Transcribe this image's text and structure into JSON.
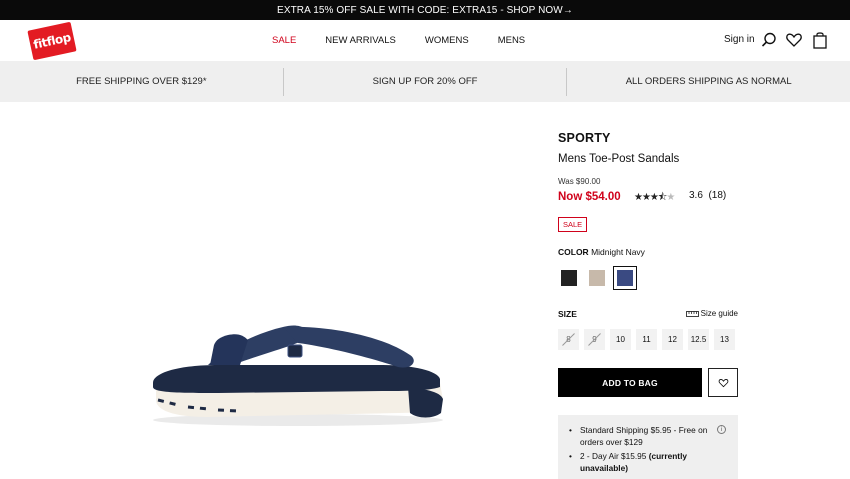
{
  "promo": {
    "text": "EXTRA 15% OFF SALE WITH CODE: EXTRA15 - SHOP NOW→"
  },
  "header": {
    "logo": "fitflop",
    "nav": [
      "SALE",
      "NEW ARRIVALS",
      "WOMENS",
      "MENS"
    ],
    "signin": "Sign in",
    "icons": [
      "search-icon",
      "heart-icon",
      "bag-icon"
    ]
  },
  "usps": [
    "FREE SHIPPING OVER $129*",
    "SIGN UP FOR 20% OFF",
    "ALL ORDERS SHIPPING AS NORMAL"
  ],
  "product": {
    "brand": "SPORTY",
    "name": "Mens Toe-Post Sandals",
    "was_price": "Was $90.00",
    "now_price": "Now $54.00",
    "rating_value": 3.6,
    "rating_text": "3.6",
    "review_count": "(18)",
    "badge": "SALE",
    "color_label": "COLOR",
    "color_value": "Midnight Navy",
    "swatches": [
      {
        "name": "Black",
        "color": "#222222",
        "selected": false
      },
      {
        "name": "Stone",
        "color": "#c7b9aa",
        "selected": false
      },
      {
        "name": "Midnight Navy",
        "color": "#3a4a82",
        "selected": true
      }
    ],
    "size_label": "SIZE",
    "size_guide": "Size guide",
    "sizes": [
      {
        "label": "8",
        "available": false
      },
      {
        "label": "9",
        "available": false
      },
      {
        "label": "10",
        "available": true
      },
      {
        "label": "11",
        "available": true
      },
      {
        "label": "12",
        "available": true
      },
      {
        "label": "12.5",
        "available": true
      },
      {
        "label": "13",
        "available": true
      }
    ],
    "add_to_bag": "ADD TO BAG"
  },
  "shipping": {
    "line1": "Standard Shipping $5.95 - Free on orders over $129",
    "line2_prefix": "2 - Day Air $15.95 ",
    "line2_bold": "(currently unavailable)"
  },
  "colors": {
    "accent": "#d0021b",
    "logo_red": "#e31b23",
    "usp_bg": "#efefef"
  }
}
